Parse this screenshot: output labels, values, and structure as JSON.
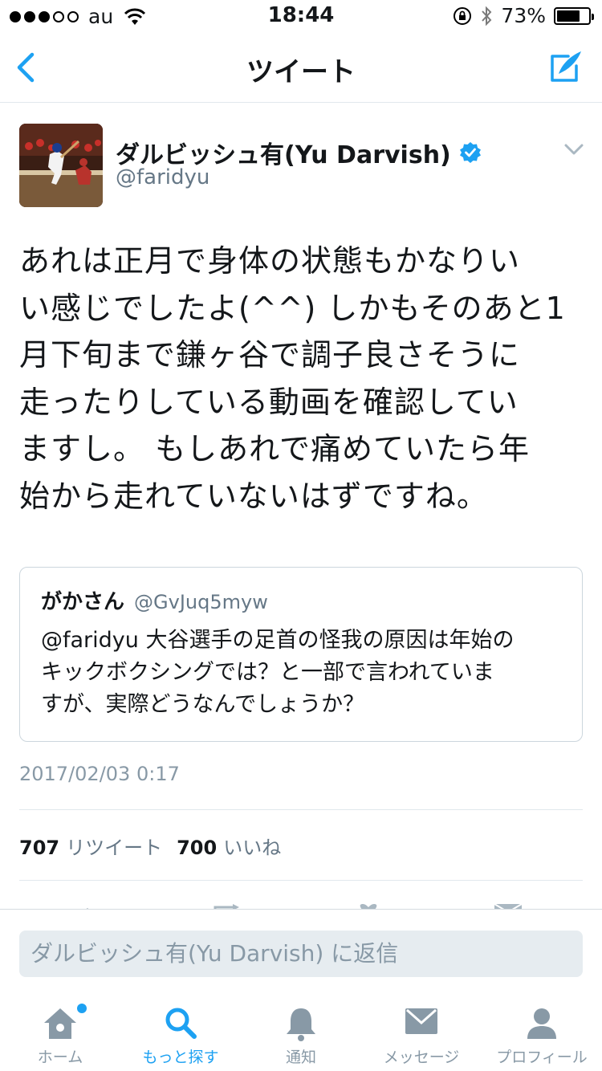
{
  "status_bar": {
    "carrier": "au",
    "time": "18:44",
    "battery_percent": "73%",
    "battery_level": 0.73
  },
  "nav": {
    "title": "ツイート"
  },
  "tweet": {
    "author_name": "ダルビッシュ有(Yu Darvish)",
    "handle": "@faridyu",
    "text_lines": [
      "あれは正月で身体の状態もかなりい",
      "い感じでしたよ(^^) しかもそのあと1",
      "月下旬まで鎌ヶ谷で調子良さそうに",
      "走ったりしている動画を確認してい",
      "ますし。 もしあれで痛めていたら年",
      "始から走れていないはずですね。"
    ],
    "timestamp": "2017/02/03 0:17",
    "retweet_count": "707",
    "retweet_label": "リツイート",
    "like_count": "700",
    "like_label": "いいね"
  },
  "quote": {
    "name": "がかさん",
    "handle": "@GvJuq5myw",
    "text_lines": [
      "@faridyu 大谷選手の足首の怪我の原因は年始の",
      "キックボクシングでは？と一部で言われていま",
      "すが、実際どうなんでしょうか？"
    ]
  },
  "reply": {
    "placeholder": "ダルビッシュ有(Yu Darvish) に返信"
  },
  "tabbar": {
    "items": [
      {
        "label": "ホーム",
        "icon": "home-icon"
      },
      {
        "label": "もっと探す",
        "icon": "search-icon"
      },
      {
        "label": "通知",
        "icon": "bell-icon"
      },
      {
        "label": "メッセージ",
        "icon": "envelope-icon"
      },
      {
        "label": "プロフィール",
        "icon": "person-icon"
      }
    ],
    "active_index": 1
  },
  "colors": {
    "accent": "#1da1f2",
    "secondary_text": "#657786",
    "muted_text": "#8899a6"
  }
}
